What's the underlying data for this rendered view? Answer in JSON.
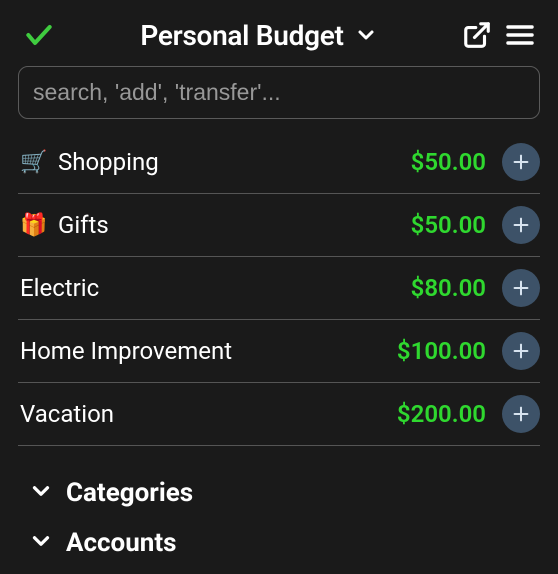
{
  "header": {
    "title": "Personal Budget"
  },
  "search": {
    "placeholder": "search, 'add', 'transfer'..."
  },
  "items": [
    {
      "icon": "🛒",
      "label": "Shopping",
      "amount": "$50.00"
    },
    {
      "icon": "🎁",
      "label": "Gifts",
      "amount": "$50.00"
    },
    {
      "icon": "",
      "label": "Electric",
      "amount": "$80.00"
    },
    {
      "icon": "",
      "label": "Home Improvement",
      "amount": "$100.00"
    },
    {
      "icon": "",
      "label": "Vacation",
      "amount": "$200.00"
    }
  ],
  "sections": [
    {
      "label": "Categories"
    },
    {
      "label": "Accounts"
    }
  ],
  "colors": {
    "accent_green": "#2fd82f",
    "check_green": "#3fcc3f",
    "plus_bg": "#3d5268"
  }
}
